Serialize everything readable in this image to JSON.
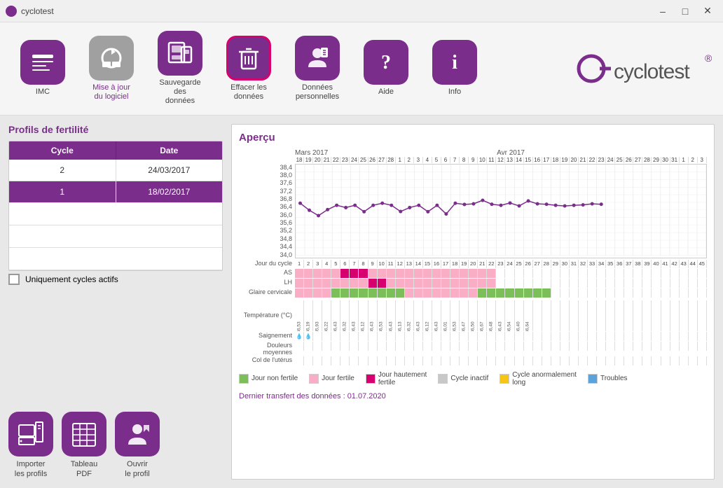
{
  "window": {
    "title": "cyclotest",
    "min_label": "–",
    "max_label": "□",
    "close_label": "✕"
  },
  "toolbar": {
    "items": [
      {
        "id": "imc",
        "label": "IMC",
        "icon": "📏",
        "selected": false,
        "dimmed": false
      },
      {
        "id": "mise-a-jour",
        "label": "Mise à jour\ndu logiciel",
        "icon": "🔄",
        "selected": false,
        "dimmed": true
      },
      {
        "id": "sauvegarde",
        "label": "Sauvegarde des\ndonnées",
        "icon": "💾",
        "selected": false,
        "dimmed": false
      },
      {
        "id": "effacer",
        "label": "Effacer les\ndonnées",
        "icon": "🗑",
        "selected": true,
        "dimmed": false
      },
      {
        "id": "donnees",
        "label": "Données\npersonnelles",
        "icon": "👤",
        "selected": false,
        "dimmed": false
      },
      {
        "id": "aide",
        "label": "Aide",
        "icon": "❓",
        "selected": false,
        "dimmed": false
      },
      {
        "id": "info",
        "label": "Info",
        "icon": "ℹ",
        "selected": false,
        "dimmed": false
      }
    ]
  },
  "left": {
    "section_title": "Profils de fertilité",
    "table": {
      "col1": "Cycle",
      "col2": "Date",
      "rows": [
        {
          "cycle": "2",
          "date": "24/03/2017",
          "active": false
        },
        {
          "cycle": "1",
          "date": "18/02/2017",
          "active": true
        }
      ]
    },
    "checkbox_label": "Uniquement cycles actifs",
    "buttons": [
      {
        "id": "importer",
        "label": "Importer\nles profils",
        "icon": "🖥"
      },
      {
        "id": "tableau",
        "label": "Tableau\nPDF",
        "icon": "📅"
      },
      {
        "id": "ouvrir",
        "label": "Ouvrir\nle profil",
        "icon": "👧"
      }
    ]
  },
  "right": {
    "title": "Aperçu",
    "month1": "Mars 2017",
    "month2": "Avr 2017",
    "y_labels": [
      "38,4",
      "38,0",
      "37,6",
      "37,2",
      "36,8",
      "36,4",
      "36,0",
      "35,6",
      "35,2",
      "34,8",
      "34,4",
      "34,0"
    ],
    "day_label": "Jour du cycle",
    "as_label": "AS",
    "lh_label": "LH",
    "cervical_label": "Glaire cervicale",
    "temp_label": "Température (°C)",
    "saignement_label": "Saignement",
    "douleurs_label": "Douleurs moyennes",
    "col_label": "Col de l'utérus",
    "day_numbers": [
      "1",
      "2",
      "3",
      "4",
      "5",
      "6",
      "7",
      "8",
      "9",
      "10",
      "11",
      "12",
      "13",
      "14",
      "15",
      "16",
      "17",
      "18",
      "19",
      "20",
      "21",
      "22",
      "23",
      "24",
      "25",
      "26",
      "27",
      "28",
      "29",
      "30",
      "31",
      "32",
      "33",
      "34",
      "35",
      "36",
      "37",
      "38",
      "39",
      "40",
      "41",
      "42",
      "43",
      "44",
      "45"
    ],
    "col_numbers_top": [
      "18",
      "19",
      "20",
      "21",
      "22",
      "23",
      "24",
      "25",
      "26",
      "27",
      "28",
      "1",
      "2",
      "3",
      "4",
      "5",
      "6",
      "7",
      "8",
      "9",
      "10",
      "11",
      "12",
      "13",
      "14",
      "15",
      "16",
      "17",
      "18",
      "19",
      "20",
      "21",
      "22",
      "23",
      "24",
      "25",
      "26",
      "27",
      "28",
      "29",
      "30",
      "31",
      "1",
      "2",
      "3"
    ],
    "temperatures": [
      "36,53",
      "36,19",
      "35,93",
      "36,22",
      "36,43",
      "36,32",
      "36,43",
      "36,12",
      "36,43",
      "36,53",
      "36,43",
      "36,13",
      "36,32",
      "36,43",
      "36,12",
      "36,43",
      "36,01",
      "36,53",
      "36,47",
      "36,50",
      "36,67",
      "36,48",
      "36,43",
      "36,54",
      "36,40",
      "36,64"
    ],
    "legend": [
      {
        "color": "#7cbf5a",
        "label": "Jour non fertile"
      },
      {
        "color": "#f9aec5",
        "label": "Jour fertile"
      },
      {
        "color": "#d6006e",
        "label": "Jour hautement\nfertile"
      },
      {
        "color": "#c8c8c8",
        "label": "Cycle inactif"
      },
      {
        "color": "#f5c518",
        "label": "Cycle anormalement\nlong"
      }
    ],
    "troubles_color": "#5ba3d9",
    "transfer_date": "Dernier transfert des données : 01.07.2020"
  }
}
